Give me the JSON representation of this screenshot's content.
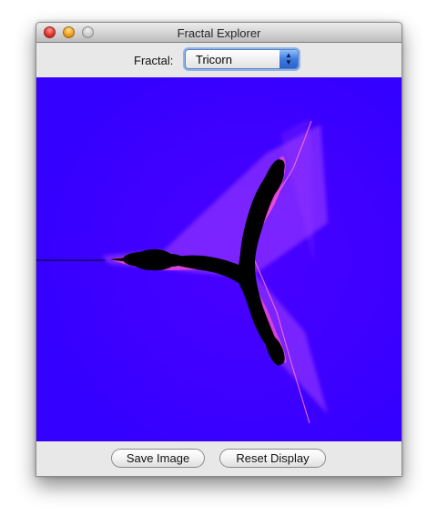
{
  "window": {
    "title": "Fractal Explorer"
  },
  "toolbar": {
    "fractal_label": "Fractal:",
    "fractal_select": {
      "selected": "Tricorn",
      "arrows_icon": "updown-arrows-icon"
    }
  },
  "canvas": {
    "background_color": "#3a00ff",
    "set_color": "#000000",
    "edge_color": "#ff55cc"
  },
  "buttons": {
    "save_label": "Save Image",
    "reset_label": "Reset Display"
  }
}
